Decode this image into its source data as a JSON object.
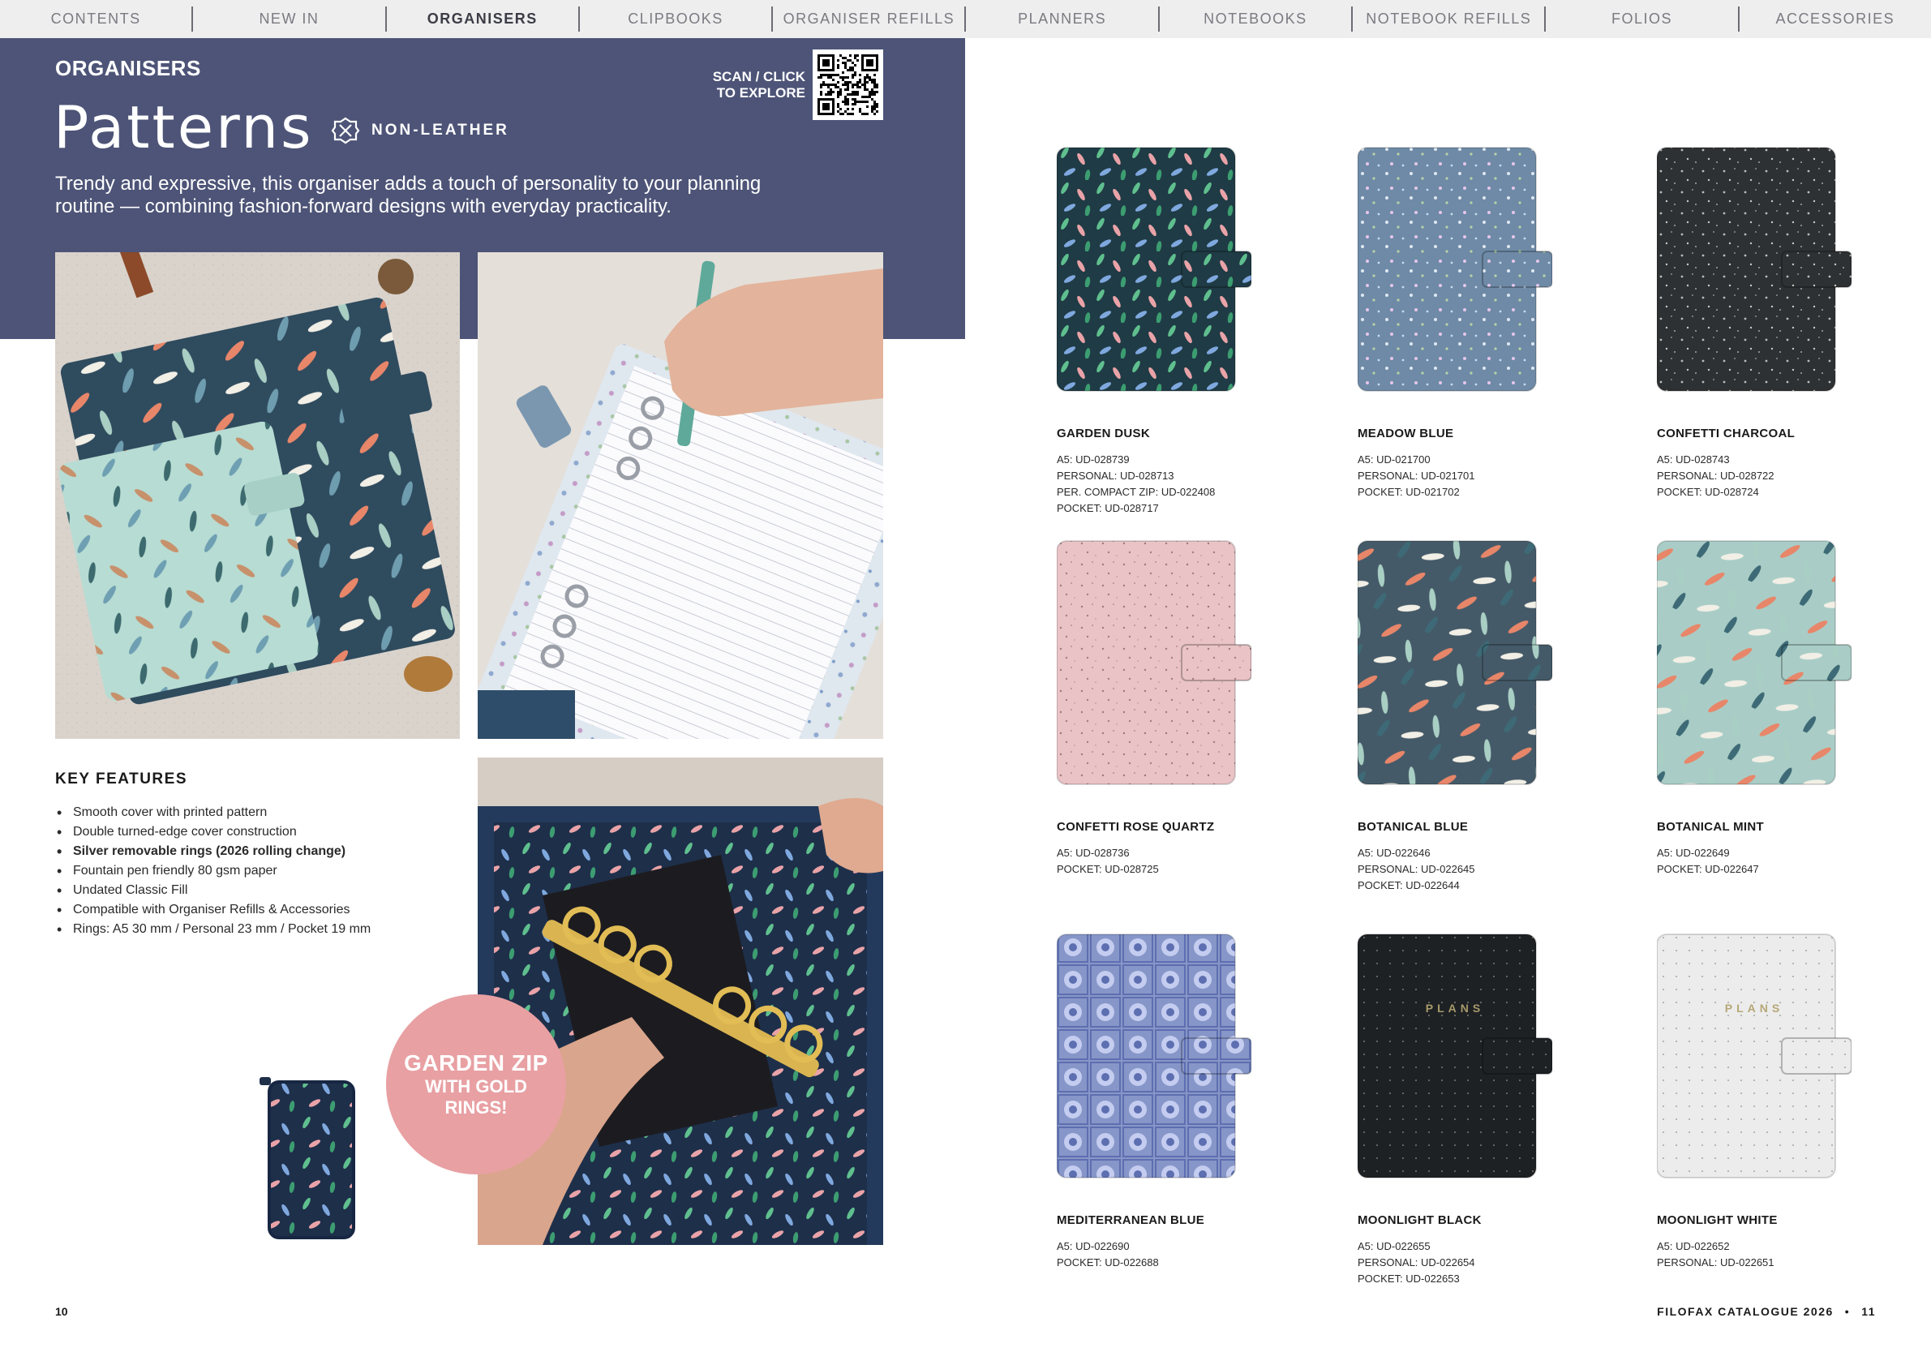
{
  "nav": [
    {
      "label": "CONTENTS",
      "active": false
    },
    {
      "label": "NEW IN",
      "active": false
    },
    {
      "label": "ORGANISERS",
      "active": true
    },
    {
      "label": "CLIPBOOKS",
      "active": false
    },
    {
      "label": "ORGANISER REFILLS",
      "active": false
    },
    {
      "label": "PLANNERS",
      "active": false
    },
    {
      "label": "NOTEBOOKS",
      "active": false
    },
    {
      "label": "NOTEBOOK REFILLS",
      "active": false
    },
    {
      "label": "FOLIOS",
      "active": false
    },
    {
      "label": "ACCESSORIES",
      "active": false
    }
  ],
  "hero": {
    "section_label": "ORGANISERS",
    "title": "Patterns",
    "material": "NON-LEATHER",
    "description_line1": "Trendy and expressive, this organiser adds a touch of personality to your planning",
    "description_line2": "routine — combining fashion-forward designs with everyday practicality.",
    "scan_line1": "SCAN / CLICK",
    "scan_line2": "TO EXPLORE",
    "bg_color": "#4d5477"
  },
  "features": {
    "heading": "KEY FEATURES",
    "items": [
      {
        "text": "Smooth cover with printed pattern",
        "bold": false
      },
      {
        "text": "Double turned-edge cover construction",
        "bold": false
      },
      {
        "text": "Silver removable rings (2026 rolling change)",
        "bold": true
      },
      {
        "text": "Fountain pen friendly 80 gsm paper",
        "bold": false
      },
      {
        "text": "Undated Classic Fill",
        "bold": false
      },
      {
        "text": "Compatible with Organiser Refills & Accessories",
        "bold": false
      },
      {
        "text": "Rings: A5 30 mm / Personal 23 mm / Pocket 19 mm",
        "bold": false
      }
    ]
  },
  "promo": {
    "line1": "GARDEN ZIP",
    "line2": "WITH GOLD",
    "line3": "RINGS!",
    "color": "#e8a0a3"
  },
  "products": [
    {
      "name": "GARDEN DUSK",
      "codes": [
        "A5: UD-028739",
        "PERSONAL: UD-028713",
        "PER. COMPACT ZIP: UD-022408",
        "POCKET: UD-028717"
      ],
      "base": "#1f3b45",
      "pattern": "leaves-dark",
      "tab": "#2e4f55"
    },
    {
      "name": "MEADOW BLUE",
      "codes": [
        "A5: UD-021700",
        "PERSONAL: UD-021701",
        "POCKET: UD-021702"
      ],
      "base": "#6e8aa6",
      "pattern": "meadow",
      "tab": "#7b97b0"
    },
    {
      "name": "CONFETTI CHARCOAL",
      "codes": [
        "A5: UD-028743",
        "PERSONAL: UD-028722",
        "POCKET: UD-028724"
      ],
      "base": "#2e3133",
      "pattern": "confetti-light",
      "tab": "#35393b"
    },
    {
      "name": "CONFETTI ROSE QUARTZ",
      "codes": [
        "A5: UD-028736",
        "POCKET: UD-028725"
      ],
      "base": "#e9c3c6",
      "pattern": "confetti-dark",
      "tab": "#e9c3c6"
    },
    {
      "name": "BOTANICAL BLUE",
      "codes": [
        "A5: UD-022646",
        "PERSONAL: UD-022645",
        "POCKET: UD-022644"
      ],
      "base": "#455a68",
      "pattern": "botanical",
      "tab": "#455a68"
    },
    {
      "name": "BOTANICAL MINT",
      "codes": [
        "A5: UD-022649",
        "POCKET: UD-022647"
      ],
      "base": "#a9cdc6",
      "pattern": "botanical",
      "tab": "#a9cdc6"
    },
    {
      "name": "MEDITERRANEAN BLUE",
      "codes": [
        "A5: UD-022690",
        "POCKET: UD-022688"
      ],
      "base": "#8796c8",
      "pattern": "tiles",
      "tab": "#8d9bcc"
    },
    {
      "name": "MOONLIGHT BLACK",
      "codes": [
        "A5: UD-022655",
        "PERSONAL: UD-022654",
        "POCKET: UD-022653"
      ],
      "base": "#1e2124",
      "pattern": "dots-plans-dark",
      "tab": "#1e2124",
      "cover_text": "PLANS"
    },
    {
      "name": "MOONLIGHT WHITE",
      "codes": [
        "A5: UD-022652",
        "PERSONAL: UD-022651"
      ],
      "base": "#ececec",
      "pattern": "dots-plans-light",
      "tab": "#ececec",
      "cover_text": "PLANS"
    }
  ],
  "footer": {
    "left_page": "10",
    "right_label": "FILOFAX CATALOGUE 2026",
    "separator": "•",
    "right_page": "11"
  }
}
